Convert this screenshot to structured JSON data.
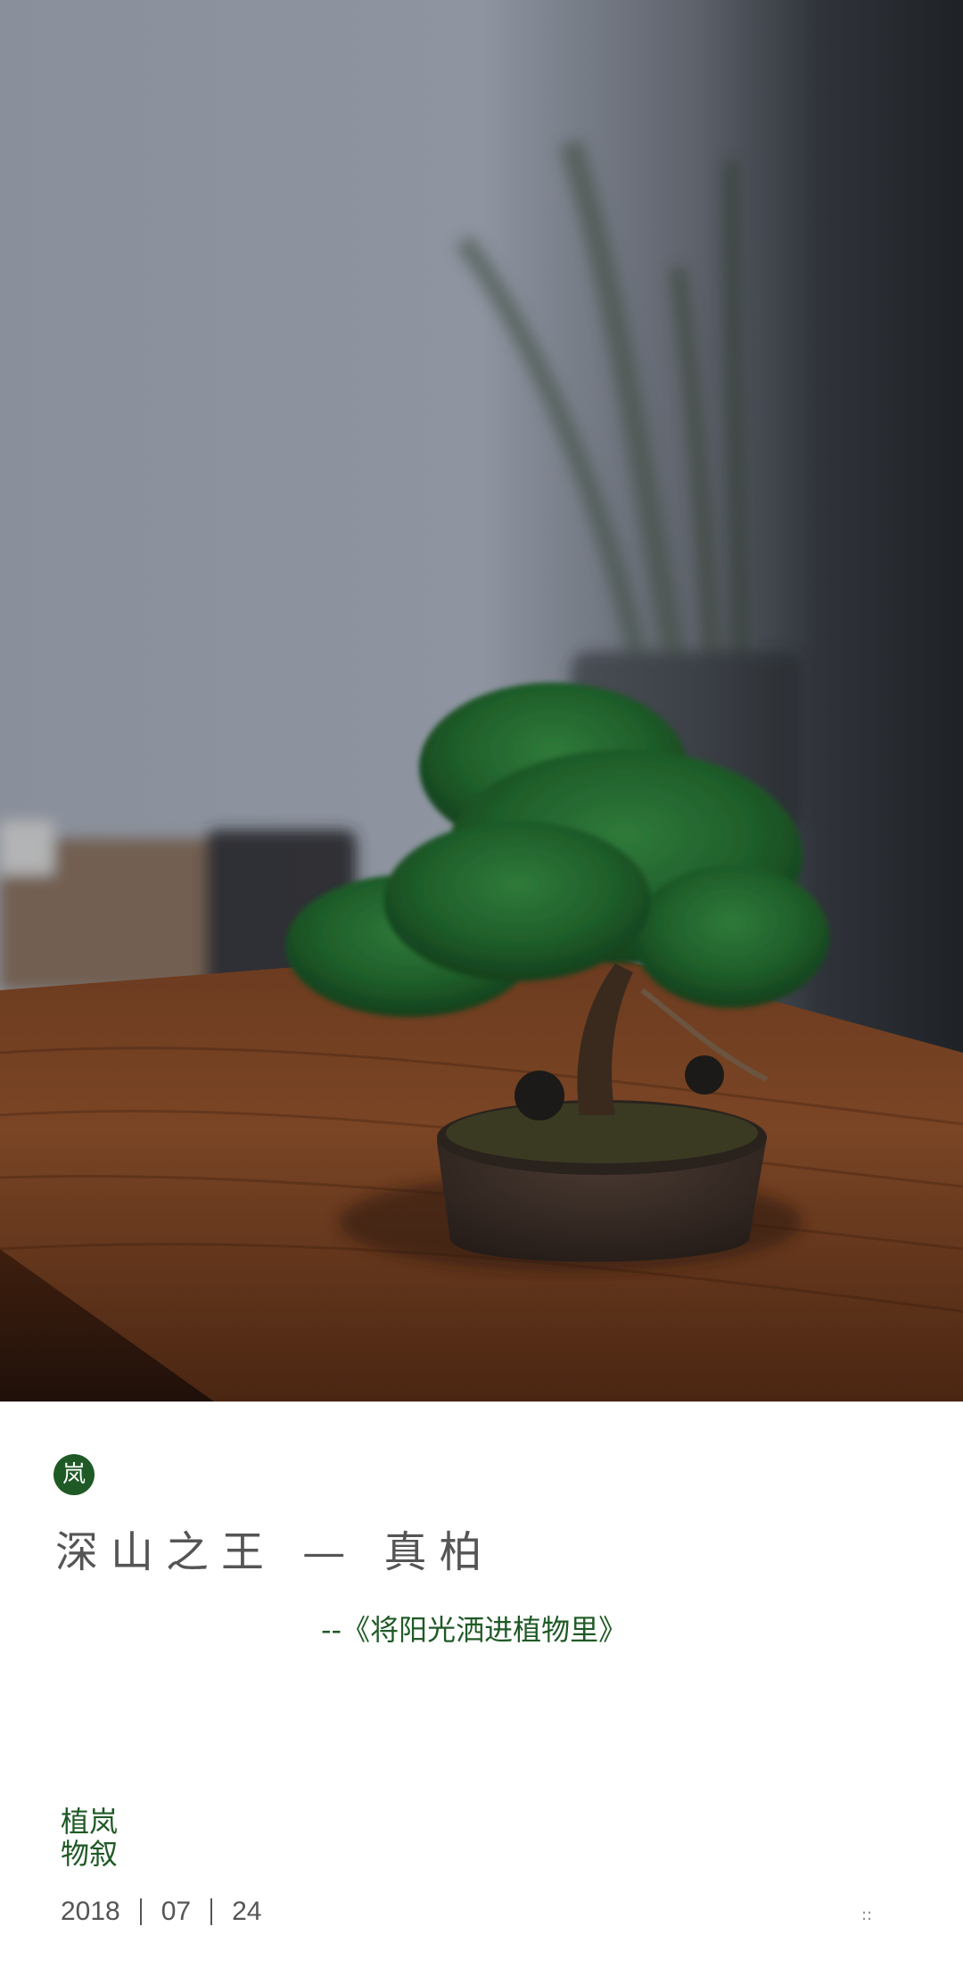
{
  "hero": {
    "description_icon": "bonsai-photo"
  },
  "badge": {
    "text": "岚"
  },
  "title": "深山之王 — 真柏",
  "subtitle": "--《将阳光洒进植物里》",
  "brand": {
    "line1": "植岚",
    "line2": "物叙"
  },
  "date": {
    "year": "2018",
    "month": "07",
    "day": "24"
  },
  "corner_mark": "::",
  "colors": {
    "accent": "#1f5a26",
    "text_gray": "#555555",
    "background": "#ffffff"
  }
}
